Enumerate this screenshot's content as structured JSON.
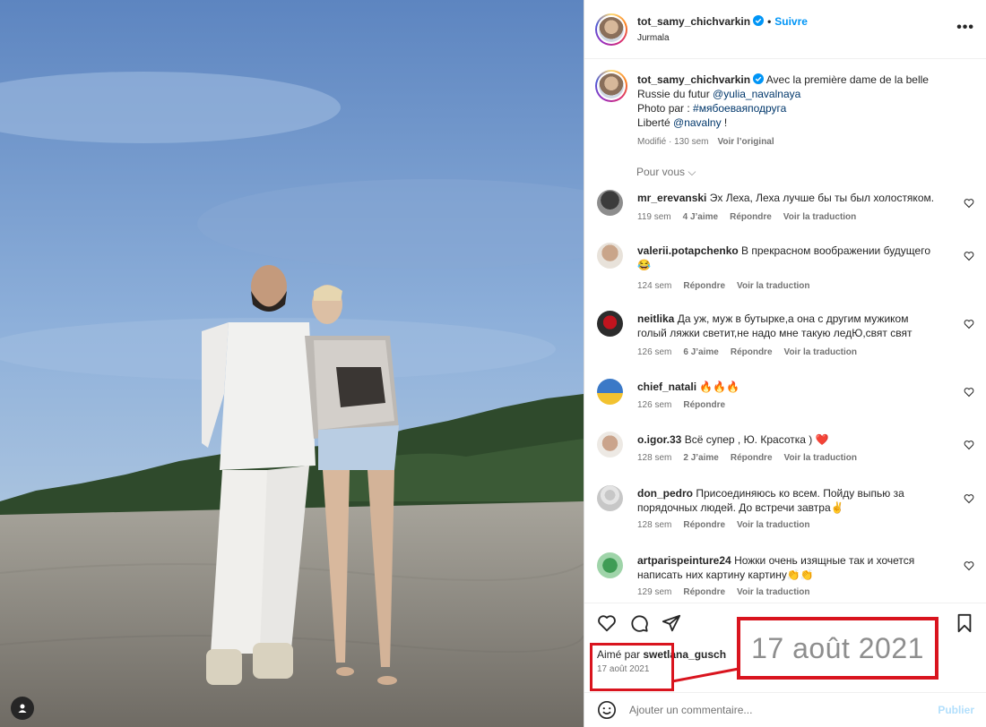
{
  "header": {
    "username": "tot_samy_chichvarkin",
    "follow_label": "Suivre",
    "location": "Jurmala"
  },
  "caption": {
    "username": "tot_samy_chichvarkin",
    "line1": "Avec la première dame de la belle",
    "line2_pre": "Russie du futur ",
    "line2_link": "@yulia_navalnaya",
    "line3_pre": "Photo par : ",
    "line3_link": "#мябоеваяподруга",
    "line4_pre": "Liberté ",
    "line4_link": "@navalny",
    "line4_post": " !",
    "edited": "Modifié · 130 sem",
    "see_original": "Voir l’original"
  },
  "for_you_label": "Pour vous",
  "comments": [
    {
      "username": "mr_erevanski",
      "text": "Эх Леха, Леха лучше бы ты был холостяком.",
      "age": "119 sem",
      "likes": "4 J’aime",
      "reply": "Répondre",
      "translate": "Voir la traduction"
    },
    {
      "username": "valerii.potapchenko",
      "text": "В прекрасном воображении будущего",
      "text2": "😂",
      "age": "124 sem",
      "likes": "",
      "reply": "Répondre",
      "translate": "Voir la traduction"
    },
    {
      "username": "neitlika",
      "text": "Да уж, муж в бутырке,а она с другим мужиком",
      "text2": "голый ляжки светит,не надо мне такую ледЮ,свят свят",
      "age": "126 sem",
      "likes": "6 J’aime",
      "reply": "Répondre",
      "translate": "Voir la traduction"
    },
    {
      "username": "chief_natali",
      "text": "🔥🔥🔥",
      "age": "126 sem",
      "likes": "",
      "reply": "Répondre",
      "translate": ""
    },
    {
      "username": "o.igor.33",
      "text": "Всё супер , Ю. Красотка ) ❤️",
      "age": "128 sem",
      "likes": "2 J’aime",
      "reply": "Répondre",
      "translate": "Voir la traduction"
    },
    {
      "username": "don_pedro",
      "text": "Присоединяюсь ко всем. Пойду выпью за",
      "text2": "порядочных людей. До встречи завтра✌️",
      "age": "128 sem",
      "likes": "",
      "reply": "Répondre",
      "translate": "Voir la traduction"
    },
    {
      "username": "artparispeinture24",
      "text": "Ножки очень изящные так и хочется",
      "text2": "написать них картину картину👏👏",
      "age": "129 sem",
      "likes": "",
      "reply": "Répondre",
      "translate": "Voir la traduction"
    }
  ],
  "likes": {
    "prefix": "Aimé par ",
    "username": "swetlana_gusch"
  },
  "post_date": "17 août 2021",
  "zoom_date": "17 août 2021",
  "add_comment": {
    "placeholder": "Ajouter un commentaire...",
    "publish_label": "Publier"
  },
  "colors": {
    "accent_blue": "#0095f6",
    "annotation_red": "#d9141e",
    "muted_text": "#737373"
  }
}
